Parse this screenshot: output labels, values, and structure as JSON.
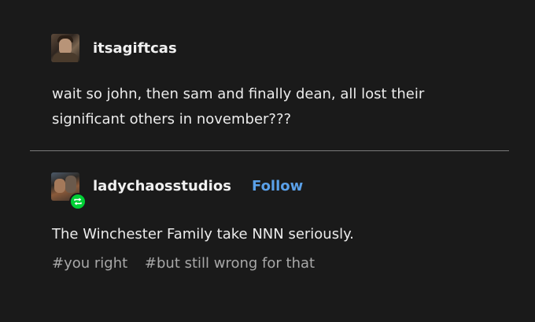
{
  "posts": [
    {
      "username": "itsagiftcas",
      "text": "wait so john, then sam and finally dean, all lost their significant others in november???"
    },
    {
      "username": "ladychaosstudios",
      "follow_label": "Follow",
      "text": "The Winchester Family take NNN seriously.",
      "tags": [
        "#you right",
        "#but still wrong for that"
      ]
    }
  ],
  "colors": {
    "background": "#1a1a1a",
    "text": "#ececec",
    "follow_link": "#5aa0e8",
    "tag_text": "#a8a8a8",
    "reblog_badge": "#00cf35",
    "divider": "#7a7a7a"
  },
  "icons": {
    "reblog_badge": "reblog-icon"
  }
}
